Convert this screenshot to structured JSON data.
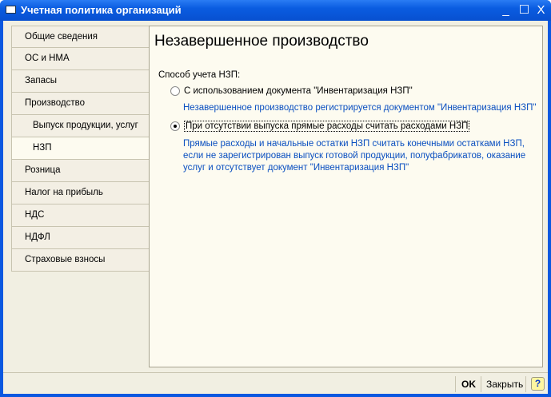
{
  "window": {
    "title": "Учетная политика организаций",
    "minimize": "_",
    "maximize": "☐",
    "close": "X"
  },
  "sidebar": {
    "items": [
      {
        "label": "Общие сведения"
      },
      {
        "label": "ОС и НМА"
      },
      {
        "label": "Запасы"
      },
      {
        "label": "Производство"
      },
      {
        "label": "Выпуск продукции, услуг"
      },
      {
        "label": "НЗП"
      },
      {
        "label": "Розница"
      },
      {
        "label": "Налог на прибыль"
      },
      {
        "label": "НДС"
      },
      {
        "label": "НДФЛ"
      },
      {
        "label": "Страховые взносы"
      }
    ]
  },
  "main": {
    "title": "Незавершенное производство",
    "group_label": "Способ учета НЗП:",
    "options": [
      {
        "label": "С использованием документа \"Инвентаризация НЗП\"",
        "selected": false,
        "description": "Незавершенное производство регистрируется документом \"Инвентаризация НЗП\""
      },
      {
        "label": "При отсутствии выпуска прямые расходы считать расходами НЗП",
        "selected": true,
        "description_lines": [
          "Прямые расходы и начальные остатки НЗП считать конечными остатками НЗП,",
          "если не зарегистрирован выпуск готовой продукции, полуфабрикатов, оказание",
          "услуг и отсутствует документ \"Инвентаризация НЗП\""
        ]
      }
    ]
  },
  "footer": {
    "ok": "OK",
    "close": "Закрыть",
    "help": "?"
  }
}
